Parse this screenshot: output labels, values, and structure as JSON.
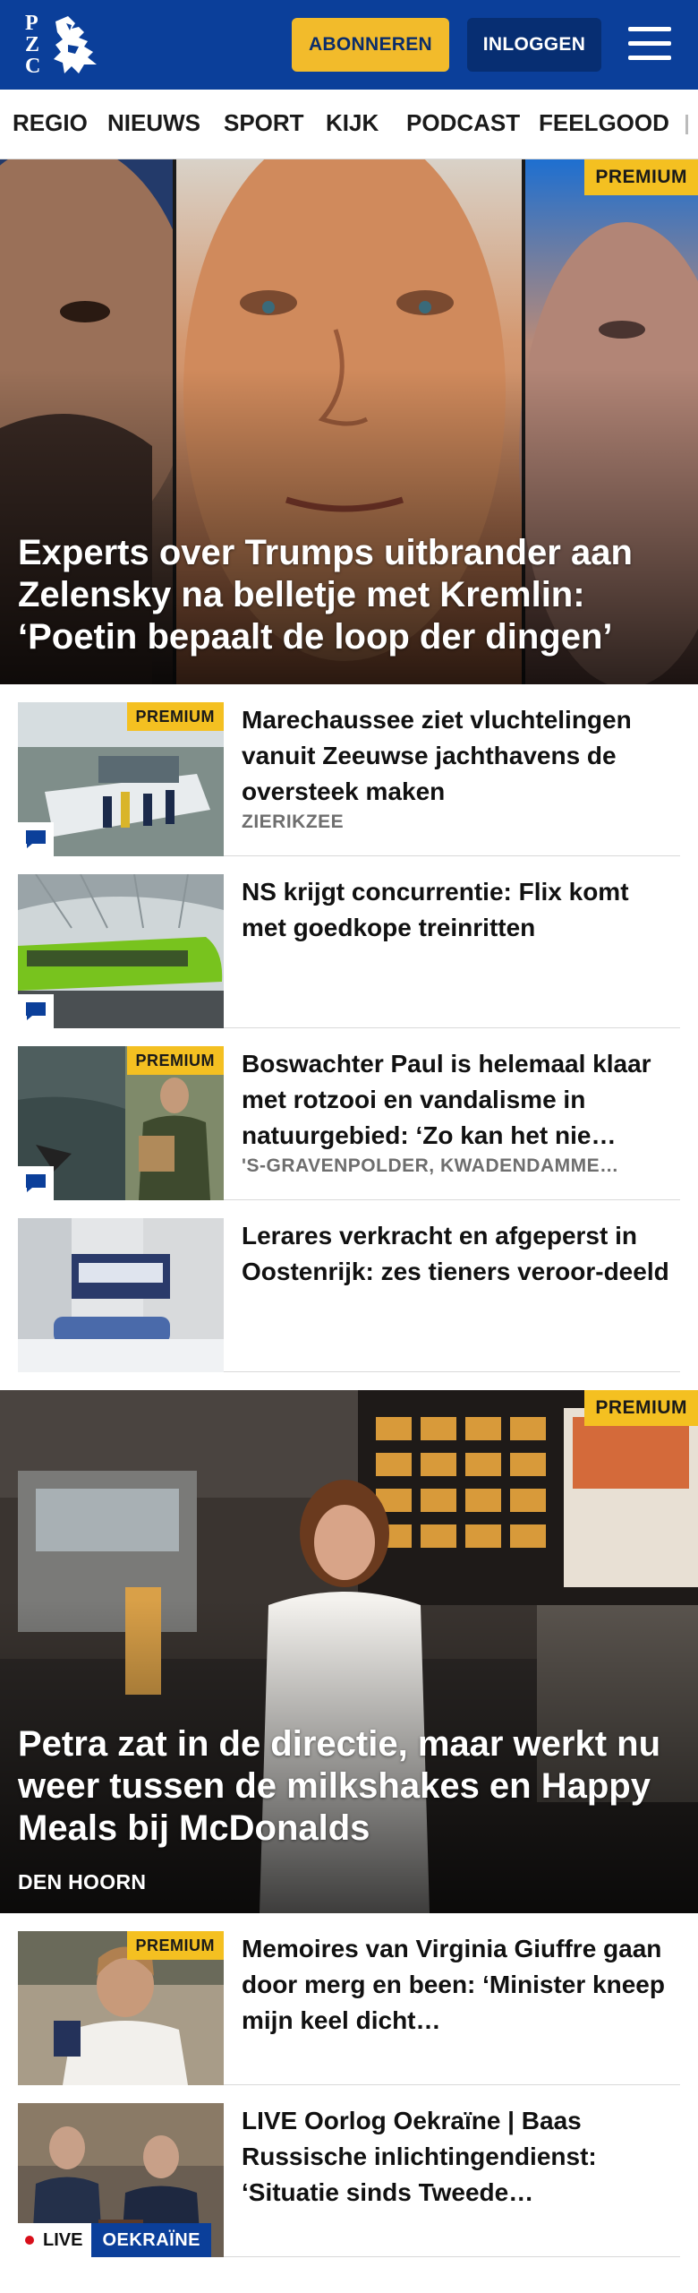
{
  "header": {
    "logo_letters": [
      "P",
      "Z",
      "C"
    ],
    "subscribe_label": "ABONNEREN",
    "login_label": "INLOGGEN",
    "colors": {
      "brand": "#0b3f9a",
      "subscribe": "#f2bb2b",
      "premium": "#f4c021"
    }
  },
  "nav": {
    "items": [
      "REGIO",
      "NIEUWS",
      "SPORT",
      "KIJK",
      "PODCAST",
      "FEELGOOD"
    ]
  },
  "hero1": {
    "badge": "PREMIUM",
    "title": "Experts over Trumps uitbrander aan Zelensky na belletje met Kremlin: ‘Poetin bepaalt de loop der dingen’"
  },
  "articles": [
    {
      "title": "Marechaussee ziet vluchtelingen vanuit Zeeuwse jachthavens de oversteek maken",
      "location": "ZIERIKZEE",
      "badge": "PREMIUM",
      "comment_icon": "comment-icon"
    },
    {
      "title": "NS krijgt concurrentie: Flix komt met goedkope treinritten",
      "comment_icon": "comment-icon"
    },
    {
      "title": "Boswachter Paul is helemaal klaar met rotzooi en vandalisme in natuurgebied: ‘Zo kan het nie…",
      "location": "'S-GRAVENPOLDER, KWADENDAMME…",
      "badge": "PREMIUM",
      "comment_icon": "comment-icon"
    },
    {
      "title": "Lerares verkracht en afgeperst in Oostenrijk: zes tieners veroor-deeld"
    }
  ],
  "hero2": {
    "badge": "PREMIUM",
    "title": "Petra zat in de directie, maar werkt nu weer tussen de milkshakes en Happy Meals bij McDonalds",
    "location": "DEN HOORN"
  },
  "articles2": [
    {
      "title": "Memoires van Virginia Giuffre gaan door merg en been: ‘Minister kneep mijn keel dicht…",
      "badge": "PREMIUM"
    },
    {
      "title": "LIVE Oorlog Oekraïne | Baas Russische inlichtingendienst: ‘Situatie sinds Tweede…",
      "live_label": "LIVE",
      "topic_label": "OEKRAÏNE"
    }
  ]
}
